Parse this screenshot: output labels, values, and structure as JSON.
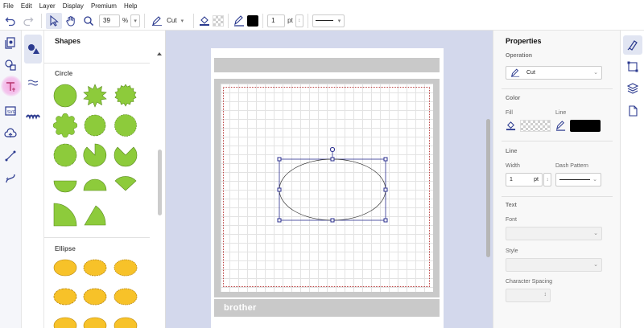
{
  "menu": {
    "items": [
      "File",
      "Edit",
      "Layer",
      "Display",
      "Premium",
      "Help"
    ]
  },
  "toolbar": {
    "zoom_value": "39",
    "zoom_unit": "%",
    "operation_label": "Cut",
    "line_width_value": "1",
    "line_width_unit": "pt"
  },
  "shapes_panel": {
    "title": "Shapes",
    "sections": [
      {
        "label": "Circle"
      },
      {
        "label": "Ellipse"
      }
    ]
  },
  "mat": {
    "logo_text": "brother"
  },
  "properties": {
    "title": "Properties",
    "operation": {
      "label": "Operation",
      "value": "Cut"
    },
    "color": {
      "label": "Color",
      "fill_label": "Fill",
      "line_label": "Line",
      "line_color": "#000000"
    },
    "line": {
      "label": "Line",
      "width_label": "Width",
      "width_value": "1",
      "width_unit": "pt",
      "dash_label": "Dash Pattern"
    },
    "text": {
      "label": "Text",
      "font_label": "Font",
      "style_label": "Style",
      "spacing_label": "Character Spacing"
    }
  },
  "colors": {
    "shape_green": "#8dcb3b",
    "shape_yellow": "#f7c229",
    "canvas_bg": "#d3d8ec",
    "selection": "#2b2f8f"
  },
  "icons": [
    "undo-icon",
    "redo-icon",
    "select-arrow-icon",
    "hand-icon",
    "zoom-icon",
    "cut-pen-icon",
    "fill-bucket-icon",
    "line-pen-icon",
    "shapes-icon",
    "text-icon",
    "upload-icon",
    "cloud-icon",
    "line-tool-icon",
    "curve-icon",
    "brush-icon",
    "layers-icon",
    "page-icon",
    "transform-icon"
  ]
}
